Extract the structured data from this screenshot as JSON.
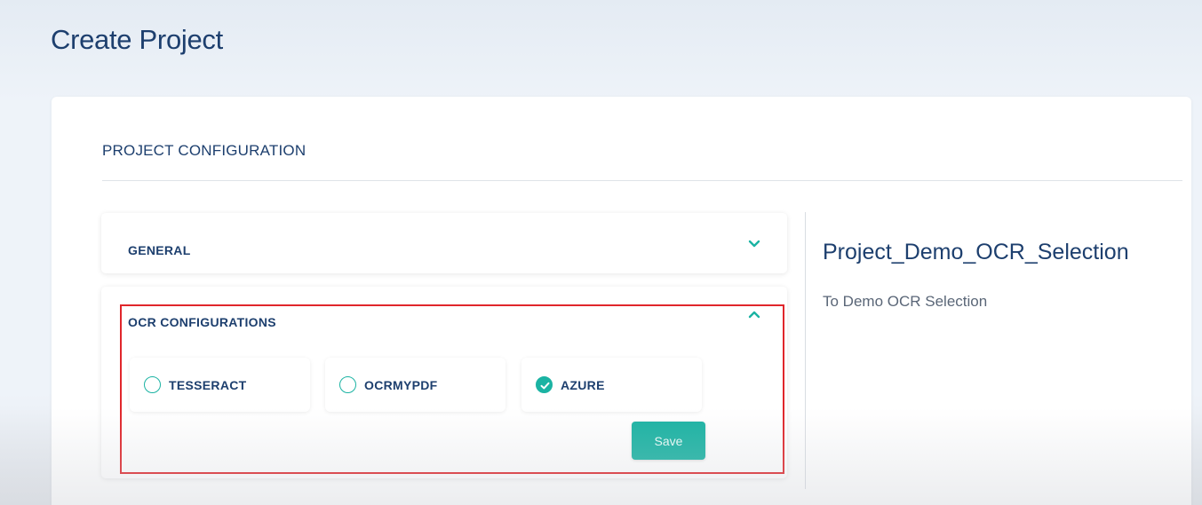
{
  "page": {
    "title": "Create Project"
  },
  "config": {
    "heading": "PROJECT CONFIGURATION"
  },
  "general": {
    "title": "GENERAL",
    "chevron_icon": "chevron-down-icon"
  },
  "ocr": {
    "title": "OCR CONFIGURATIONS",
    "chevron_icon": "chevron-up-icon",
    "options": [
      {
        "label": "TESSERACT",
        "selected": false
      },
      {
        "label": "OCRMYPDF",
        "selected": false
      },
      {
        "label": "AZURE",
        "selected": true
      }
    ],
    "save_label": "Save"
  },
  "project": {
    "name": "Project_Demo_OCR_Selection",
    "description": "To Demo OCR Selection"
  },
  "colors": {
    "accent": "#1bb3a3",
    "heading": "#1d3f6e",
    "highlight": "#e0262b"
  }
}
